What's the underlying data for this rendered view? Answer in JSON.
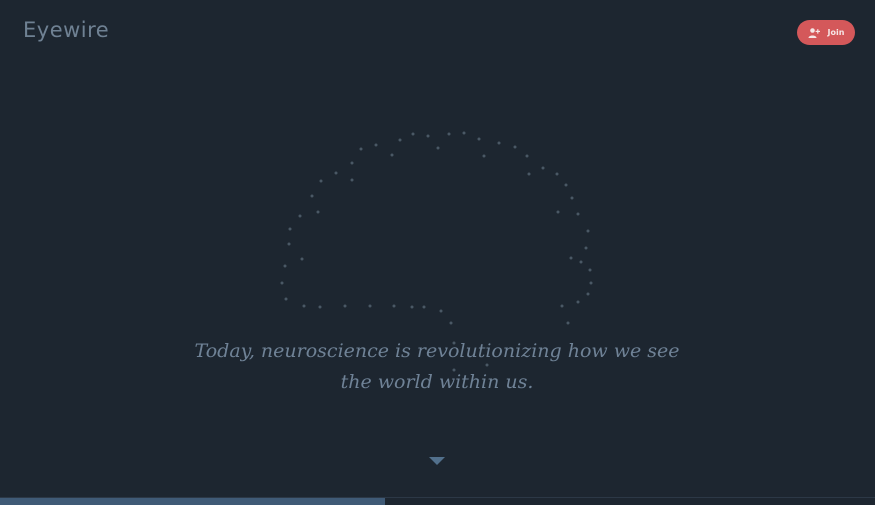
{
  "header": {
    "logo_text": "Eyewire",
    "join_label": "Join",
    "join_icon": "user-plus-icon"
  },
  "hero": {
    "tagline": "Today, neuroscience is revolutionizing how we see the world within us.",
    "scroll_icon": "caret-down-icon"
  },
  "progress": {
    "fraction": 0.44
  },
  "colors": {
    "background": "#1d2630",
    "accent": "#d4585a",
    "text_muted": "#6f8296",
    "dot": "#4a5865"
  }
}
